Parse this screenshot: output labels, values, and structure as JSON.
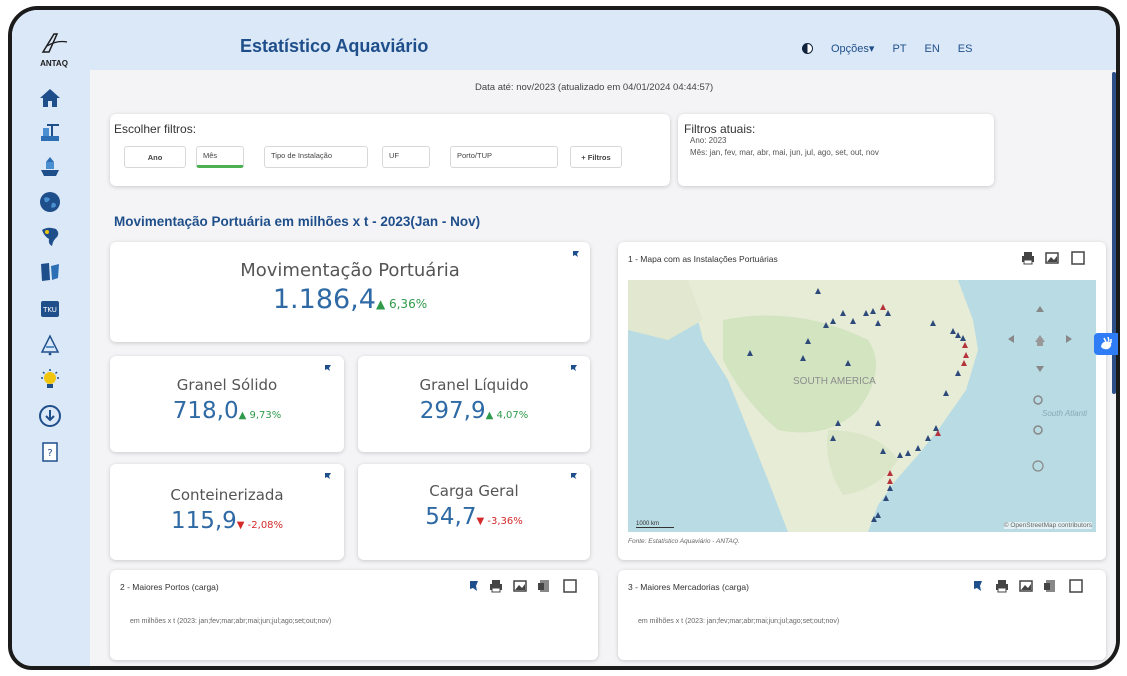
{
  "header": {
    "title": "Estatístico Aquaviário",
    "options_label": "Opções▾",
    "langs": [
      "PT",
      "EN",
      "ES"
    ]
  },
  "logo_text": "ANTAQ",
  "date_line": "Data até: nov/2023 (atualizado em 04/01/2024 04:44:57)",
  "filters": {
    "label": "Escolher filtros:",
    "ano": "Ano",
    "mes": "Mês",
    "tipo": "Tipo de Instalação",
    "uf": "UF",
    "porto": "Porto/TUP",
    "mais": "+ Filtros"
  },
  "current_filters": {
    "label": "Filtros atuais:",
    "ano": "Ano: 2023",
    "mes": "Mês: jan, fev, mar, abr, mai, jun, jul, ago, set, out, nov"
  },
  "section_title": "Movimentação Portuária em milhões x t - 2023(Jan - Nov)",
  "kpis": {
    "main": {
      "label": "Movimentação Portuária",
      "value": "1.186,4",
      "delta": "▲ 6,36%"
    },
    "granel_solido": {
      "label": "Granel Sólido",
      "value": "718,0",
      "delta": "▲ 9,73%"
    },
    "granel_liquido": {
      "label": "Granel Líquido",
      "value": "297,9",
      "delta": "▲ 4,07%"
    },
    "conteinerizada": {
      "label": "Conteinerizada",
      "value": "115,9",
      "delta": "▼ -2,08%"
    },
    "carga_geral": {
      "label": "Carga Geral",
      "value": "54,7",
      "delta": "▼ -3,36%"
    }
  },
  "map_panel": {
    "title": "1 - Mapa com as Instalações Portuárias",
    "label_south_america": "SOUTH AMERICA",
    "label_south_atlantic": "South Atlanti",
    "scale": "1000 km",
    "credit": "© OpenStreetMap contributors",
    "source": "Fonte: Estatístico Aquaviário - ANTAQ."
  },
  "ports_panel": {
    "title": "2 - Maiores Portos (carga)",
    "subtitle": "em milhões x t (2023: jan;fev;mar;abr;mai;jun;jul;ago;set;out;nov)"
  },
  "goods_panel": {
    "title": "3 - Maiores Mercadorias (carga)",
    "subtitle": "em milhões x t (2023: jan;fev;mar;abr;mai;jun;jul;ago;set;out;nov)"
  },
  "colors": {
    "brand": "#1f4f8b",
    "value": "#2f6aa5",
    "up": "#2f9a4a",
    "down": "#d42a2a",
    "marker_blue": "#2d4a7a",
    "marker_red": "#b5333b"
  }
}
